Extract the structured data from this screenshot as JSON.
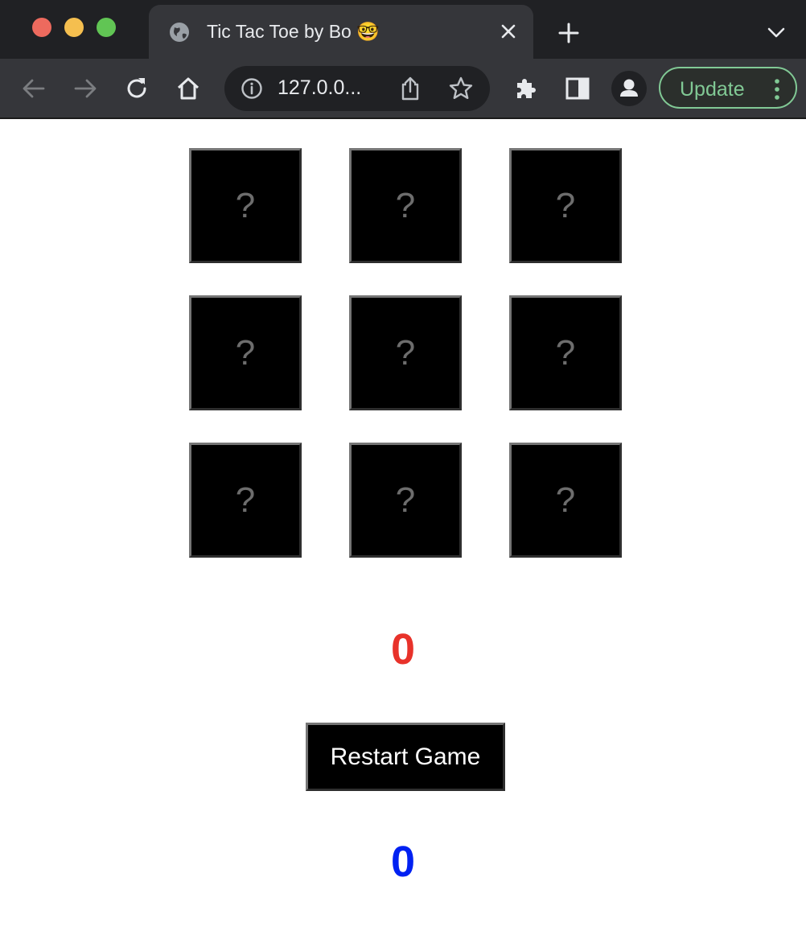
{
  "browser": {
    "tab_title": "Tic Tac Toe by Bo 🤓",
    "url": "127.0.0...",
    "update_label": "Update",
    "accent_update": "#81c995"
  },
  "game": {
    "cells": [
      "?",
      "?",
      "?",
      "?",
      "?",
      "?",
      "?",
      "?",
      "?"
    ],
    "score_red": "0",
    "score_blue": "0",
    "restart_label": "Restart Game",
    "colors": {
      "score_red": "#e8322a",
      "score_blue": "#0021f2",
      "cell_background": "#000000",
      "cell_mark": "#6d6d6d"
    }
  }
}
